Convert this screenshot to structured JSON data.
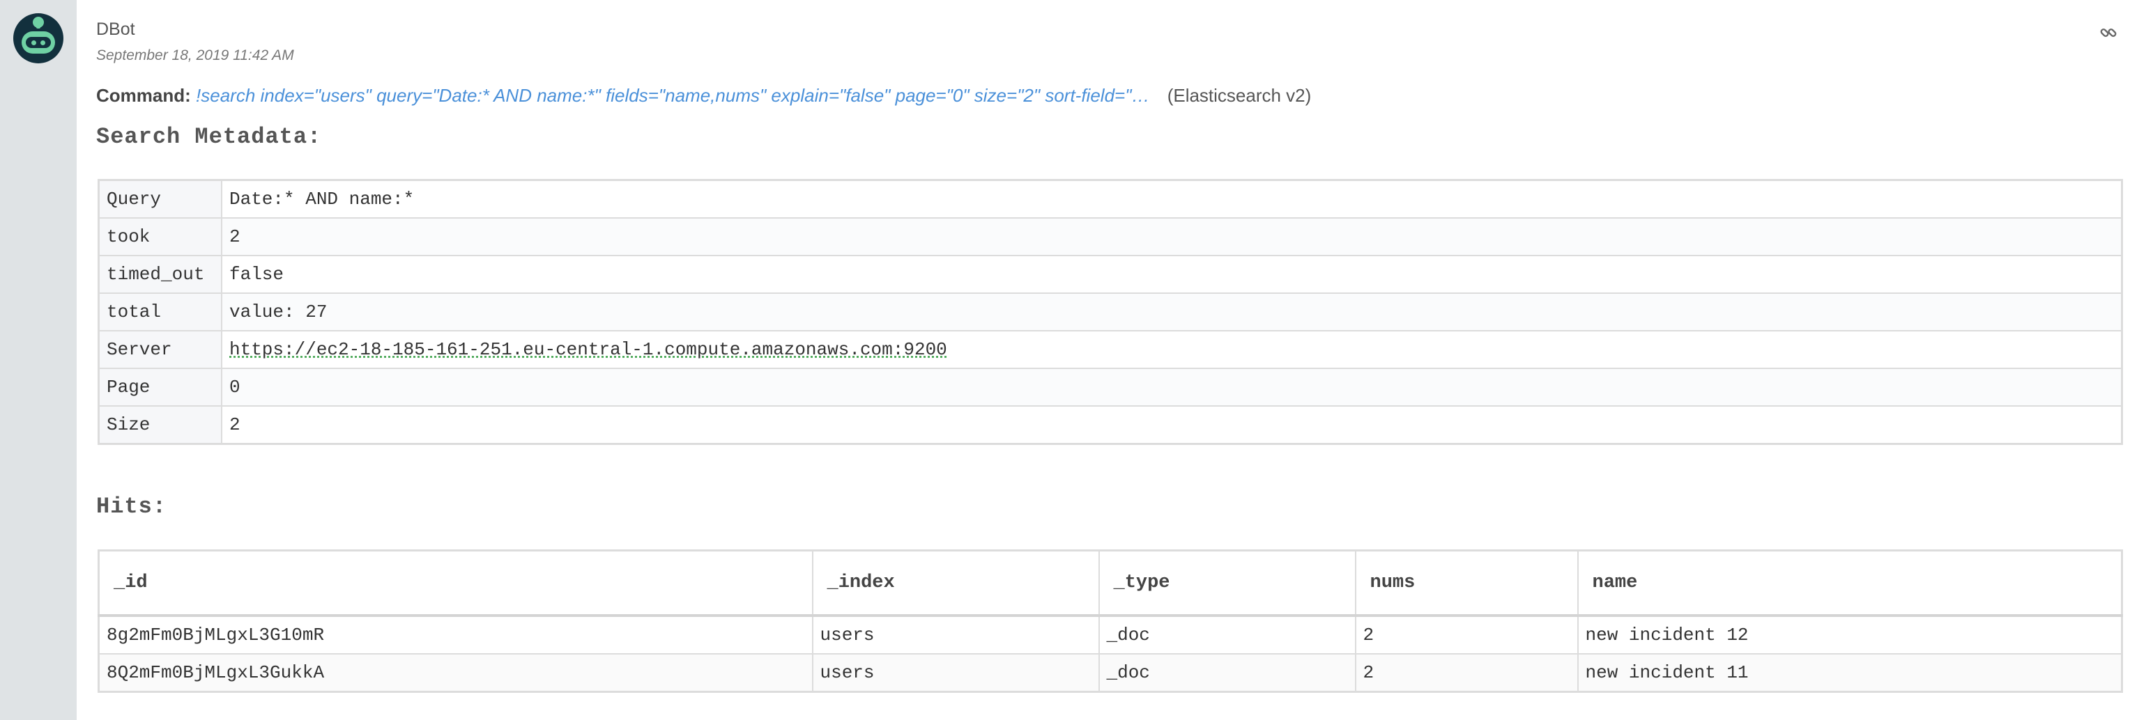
{
  "message": {
    "author": "DBot",
    "timestamp": "September 18, 2019 11:42 AM",
    "command_label": "Command:",
    "command_text": "!search index=\"users\" query=\"Date:* AND name:*\" fields=\"name,nums\" explain=\"false\" page=\"0\" size=\"2\" sort-field=\"…",
    "integration": "(Elasticsearch v2)"
  },
  "search_metadata": {
    "title": "Search Metadata:",
    "rows": [
      {
        "key": "Query",
        "value": "Date:* AND name:*"
      },
      {
        "key": "took",
        "value": "2"
      },
      {
        "key": "timed_out",
        "value": "false"
      },
      {
        "key": "total",
        "value": "value: 27"
      },
      {
        "key": "Server",
        "value": "https://ec2-18-185-161-251.eu-central-1.compute.amazonaws.com:9200"
      },
      {
        "key": "Page",
        "value": "0"
      },
      {
        "key": "Size",
        "value": "2"
      }
    ]
  },
  "hits": {
    "title": "Hits:",
    "columns": [
      "_id",
      "_index",
      "_type",
      "nums",
      "name"
    ],
    "rows": [
      [
        "8g2mFm0BjMLgxL3G10mR",
        "users",
        "_doc",
        "2",
        "new incident 12"
      ],
      [
        "8Q2mFm0BjMLgxL3GukkA",
        "users",
        "_doc",
        "2",
        "new incident 11"
      ]
    ]
  },
  "icons": {
    "avatar": "robot-avatar-icon",
    "permalink": "link-icon"
  },
  "colors": {
    "avatar_bg": "#12303d",
    "avatar_accent": "#6fd1a4",
    "command_link": "#4a90d9"
  }
}
